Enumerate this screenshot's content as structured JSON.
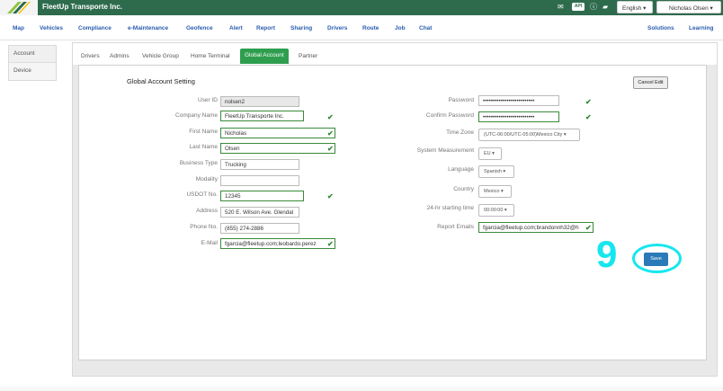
{
  "header": {
    "app_title": "FleetUp Transporte Inc.",
    "api_label": "API",
    "language": "English ▾",
    "user": "Nicholas Olsen ▾",
    "icons": [
      "mail-icon",
      "api-badge",
      "folder-icon"
    ]
  },
  "nav": {
    "items": [
      "Map",
      "Vehicles",
      "Compliance",
      "e-Maintenance",
      "Geofence",
      "Alert",
      "Report",
      "Sharing",
      "Drivers",
      "Route",
      "Job",
      "Chat"
    ],
    "right_items": [
      "Solutions",
      "Learning"
    ]
  },
  "sidebar": {
    "items": [
      "Account",
      "Device"
    ]
  },
  "tabs": [
    "Drivers",
    "Admins",
    "Vehicle Group",
    "Home Terminal",
    "Global Account",
    "Partner"
  ],
  "form": {
    "title": "Global Account Setting",
    "cancel_label": "Cancel Edit",
    "save_label": "Save",
    "left": {
      "user_id": {
        "label": "User ID",
        "value": "nolsen2"
      },
      "company_name": {
        "label": "Company Name",
        "value": "FleetUp Transporte Inc."
      },
      "first_name": {
        "label": "First Name",
        "value": "Nicholas"
      },
      "last_name": {
        "label": "Last Name",
        "value": "Olsen"
      },
      "business_type": {
        "label": "Business Type",
        "value": "Trucking"
      },
      "modality": {
        "label": "Modality",
        "value": ""
      },
      "usdot": {
        "label": "USDOT No.",
        "value": "12345"
      },
      "address": {
        "label": "Address",
        "value": "520 E. Wilson Ave. Glendal"
      },
      "phone": {
        "label": "Phone No.",
        "value": "(855) 274-2886"
      },
      "email": {
        "label": "E-Mail",
        "value": "fgarcia@fleetup.com;leobardo.perez"
      }
    },
    "right": {
      "password": {
        "label": "Password",
        "value": "••••••••••••••••••••••••••"
      },
      "confirm_password": {
        "label": "Confirm Password",
        "value": "••••••••••••••••••••••••••"
      },
      "time_zone": {
        "label": "Time Zone",
        "value": "(UTC-06:00/UTC-05:00)Mexico City ▾"
      },
      "measurement": {
        "label": "System Measurement",
        "value": "EU ▾"
      },
      "language": {
        "label": "Language",
        "value": "Spanish ▾"
      },
      "country": {
        "label": "Country",
        "value": "Mexico ▾"
      },
      "starting_time": {
        "label": "24-hr starting time",
        "value": "00:00:00 ▾"
      },
      "report_emails": {
        "label": "Report Emails",
        "value": "fgarcia@fleetup.com;brandonnh32@h"
      }
    }
  },
  "annotation": {
    "step": "9"
  },
  "colors": {
    "header_bg": "#2e6b4d",
    "nav_link": "#2a5db0",
    "active_tab": "#2e9e4e",
    "save_button": "#2a7ab8",
    "annotation": "#16e6ee"
  }
}
